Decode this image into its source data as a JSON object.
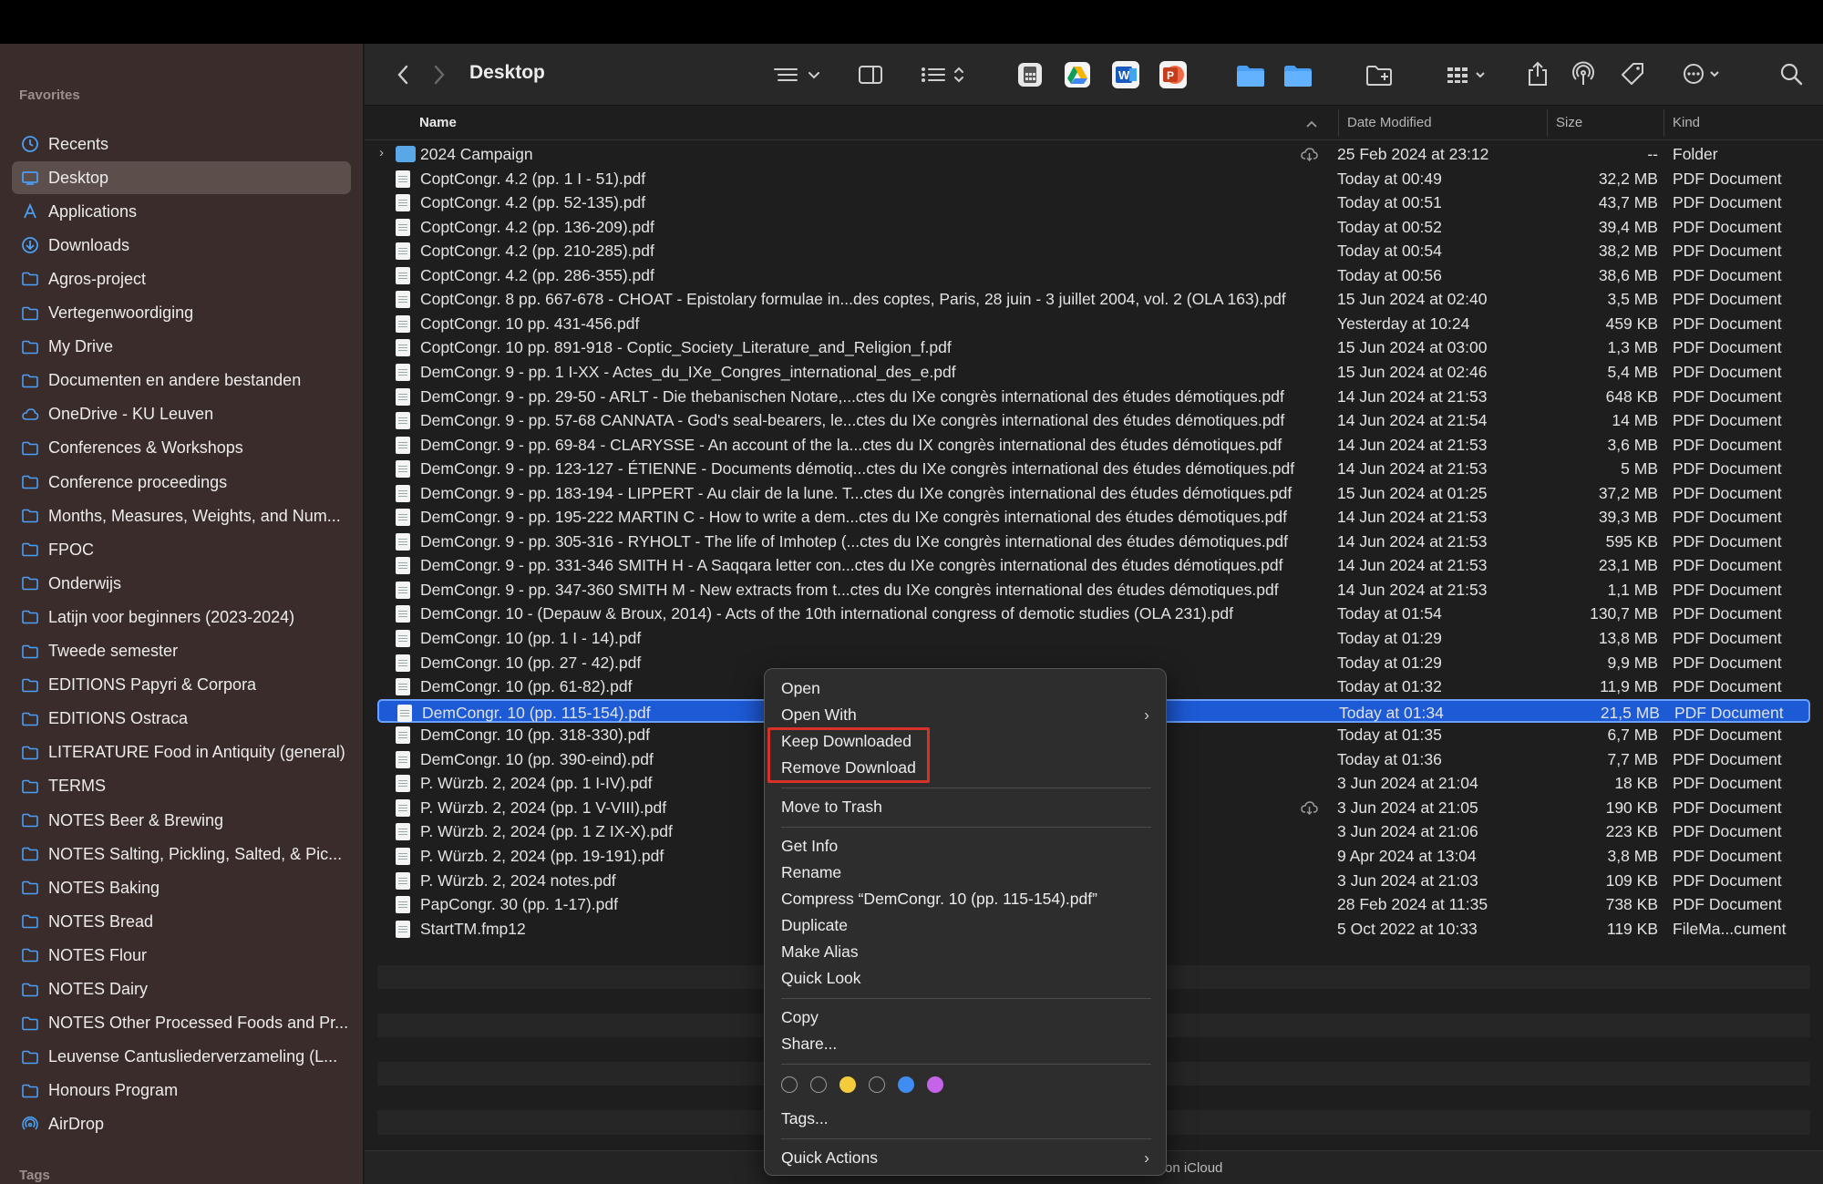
{
  "window": {
    "title": "Desktop",
    "status_text": "on iCloud"
  },
  "sidebar": {
    "favorites_label": "Favorites",
    "tags_label": "Tags",
    "items": [
      {
        "label": "Recents",
        "icon": "clock-icon"
      },
      {
        "label": "Desktop",
        "icon": "desktop-icon",
        "active": true
      },
      {
        "label": "Applications",
        "icon": "applications-icon"
      },
      {
        "label": "Downloads",
        "icon": "download-icon"
      },
      {
        "label": "Agros-project",
        "icon": "folder-icon"
      },
      {
        "label": "Vertegenwoordiging",
        "icon": "folder-icon"
      },
      {
        "label": "My Drive",
        "icon": "folder-icon"
      },
      {
        "label": "Documenten en andere bestanden",
        "icon": "folder-icon"
      },
      {
        "label": "OneDrive - KU Leuven",
        "icon": "cloud-icon"
      },
      {
        "label": "Conferences & Workshops",
        "icon": "folder-icon"
      },
      {
        "label": "Conference proceedings",
        "icon": "folder-icon"
      },
      {
        "label": "Months, Measures, Weights, and Num...",
        "icon": "folder-icon"
      },
      {
        "label": "FPOC",
        "icon": "folder-icon"
      },
      {
        "label": "Onderwijs",
        "icon": "folder-icon"
      },
      {
        "label": "Latijn voor beginners (2023-2024)",
        "icon": "folder-icon"
      },
      {
        "label": "Tweede semester",
        "icon": "folder-icon"
      },
      {
        "label": "EDITIONS Papyri & Corpora",
        "icon": "folder-icon"
      },
      {
        "label": "EDITIONS Ostraca",
        "icon": "folder-icon"
      },
      {
        "label": "LITERATURE Food in Antiquity (general)",
        "icon": "folder-icon"
      },
      {
        "label": "TERMS",
        "icon": "folder-icon"
      },
      {
        "label": "NOTES Beer & Brewing",
        "icon": "folder-icon"
      },
      {
        "label": "NOTES Salting, Pickling, Salted, & Pic...",
        "icon": "folder-icon"
      },
      {
        "label": "NOTES Baking",
        "icon": "folder-icon"
      },
      {
        "label": "NOTES Bread",
        "icon": "folder-icon"
      },
      {
        "label": "NOTES Flour",
        "icon": "folder-icon"
      },
      {
        "label": "NOTES Dairy",
        "icon": "folder-icon"
      },
      {
        "label": "NOTES Other Processed Foods and Pr...",
        "icon": "folder-icon"
      },
      {
        "label": "Leuvense Cantusliederverzameling (L...",
        "icon": "folder-icon"
      },
      {
        "label": "Honours Program",
        "icon": "folder-icon"
      },
      {
        "label": "AirDrop",
        "icon": "airdrop-icon"
      }
    ]
  },
  "columns": {
    "name": "Name",
    "date": "Date Modified",
    "size": "Size",
    "kind": "Kind"
  },
  "files": [
    {
      "name": "2024 Campaign",
      "date": "25 Feb 2024 at 23:12",
      "size": "--",
      "kind": "Folder",
      "folder": true,
      "cloud": true
    },
    {
      "name": "CoptCongr. 4.2 (pp. 1 I - 51).pdf",
      "date": "Today at 00:49",
      "size": "32,2 MB",
      "kind": "PDF Document"
    },
    {
      "name": "CoptCongr. 4.2 (pp. 52-135).pdf",
      "date": "Today at 00:51",
      "size": "43,7 MB",
      "kind": "PDF Document"
    },
    {
      "name": "CoptCongr. 4.2 (pp. 136-209).pdf",
      "date": "Today at 00:52",
      "size": "39,4 MB",
      "kind": "PDF Document"
    },
    {
      "name": "CoptCongr. 4.2 (pp. 210-285).pdf",
      "date": "Today at 00:54",
      "size": "38,2 MB",
      "kind": "PDF Document"
    },
    {
      "name": "CoptCongr. 4.2 (pp. 286-355).pdf",
      "date": "Today at 00:56",
      "size": "38,6 MB",
      "kind": "PDF Document"
    },
    {
      "name": "CoptCongr. 8 pp. 667-678 - CHOAT - Epistolary formulae in...des coptes, Paris, 28 juin - 3 juillet 2004, vol. 2 (OLA 163).pdf",
      "date": "15 Jun 2024 at 02:40",
      "size": "3,5 MB",
      "kind": "PDF Document"
    },
    {
      "name": "CoptCongr. 10 pp. 431-456.pdf",
      "date": "Yesterday at 10:24",
      "size": "459 KB",
      "kind": "PDF Document"
    },
    {
      "name": "CoptCongr. 10 pp. 891-918 - Coptic_Society_Literature_and_Religion_f.pdf",
      "date": "15 Jun 2024 at 03:00",
      "size": "1,3 MB",
      "kind": "PDF Document"
    },
    {
      "name": "DemCongr. 9 - pp. 1 I-XX - Actes_du_IXe_Congres_international_des_e.pdf",
      "date": "15 Jun 2024 at 02:46",
      "size": "5,4 MB",
      "kind": "PDF Document"
    },
    {
      "name": "DemCongr. 9 - pp. 29-50 - ARLT - Die thebanischen Notare,...ctes du IXe congrès international des études démotiques.pdf",
      "date": "14 Jun 2024 at 21:53",
      "size": "648 KB",
      "kind": "PDF Document"
    },
    {
      "name": "DemCongr. 9 - pp. 57-68 CANNATA - God's seal-bearers, le...ctes du IXe congrès international des études démotiques.pdf",
      "date": "14 Jun 2024 at 21:54",
      "size": "14 MB",
      "kind": "PDF Document"
    },
    {
      "name": "DemCongr. 9 - pp. 69-84 - CLARYSSE - An account of the la...ctes du IX congrès international des études démotiques.pdf",
      "date": "14 Jun 2024 at 21:53",
      "size": "3,6 MB",
      "kind": "PDF Document"
    },
    {
      "name": "DemCongr. 9 - pp. 123-127 - ÉTIENNE - Documents démotiq...ctes du IXe congrès international des études démotiques.pdf",
      "date": "14 Jun 2024 at 21:53",
      "size": "5 MB",
      "kind": "PDF Document"
    },
    {
      "name": "DemCongr. 9 - pp. 183-194 - LIPPERT - Au clair de la lune. T...ctes du IXe congrès international des études démotiques.pdf",
      "date": "15 Jun 2024 at 01:25",
      "size": "37,2 MB",
      "kind": "PDF Document"
    },
    {
      "name": "DemCongr. 9 - pp. 195-222 MARTIN C - How to write a dem...ctes du IXe congrès international des études démotiques.pdf",
      "date": "14 Jun 2024 at 21:53",
      "size": "39,3 MB",
      "kind": "PDF Document"
    },
    {
      "name": "DemCongr. 9 - pp. 305-316 - RYHOLT - The life of Imhotep (...ctes du IXe congrès international des études démotiques.pdf",
      "date": "14 Jun 2024 at 21:53",
      "size": "595 KB",
      "kind": "PDF Document"
    },
    {
      "name": "DemCongr. 9 - pp. 331-346 SMITH H - A Saqqara letter con...ctes du IXe congrès international des études démotiques.pdf",
      "date": "14 Jun 2024 at 21:53",
      "size": "23,1 MB",
      "kind": "PDF Document"
    },
    {
      "name": "DemCongr. 9 - pp. 347-360 SMITH M - New extracts from t...ctes du IXe congrès international des études démotiques.pdf",
      "date": "14 Jun 2024 at 21:53",
      "size": "1,1 MB",
      "kind": "PDF Document"
    },
    {
      "name": "DemCongr. 10 - (Depauw & Broux, 2014) - Acts of the 10th international congress of demotic studies (OLA 231).pdf",
      "date": "Today at 01:54",
      "size": "130,7 MB",
      "kind": "PDF Document"
    },
    {
      "name": "DemCongr. 10 (pp. 1 I - 14).pdf",
      "date": "Today at 01:29",
      "size": "13,8 MB",
      "kind": "PDF Document"
    },
    {
      "name": "DemCongr. 10 (pp. 27 - 42).pdf",
      "date": "Today at 01:29",
      "size": "9,9 MB",
      "kind": "PDF Document"
    },
    {
      "name": "DemCongr. 10 (pp. 61-82).pdf",
      "date": "Today at 01:32",
      "size": "11,9 MB",
      "kind": "PDF Document"
    },
    {
      "name": "DemCongr. 10 (pp. 115-154).pdf",
      "date": "Today at 01:34",
      "size": "21,5 MB",
      "kind": "PDF Document",
      "selected": true
    },
    {
      "name": "DemCongr. 10 (pp. 318-330).pdf",
      "date": "Today at 01:35",
      "size": "6,7 MB",
      "kind": "PDF Document"
    },
    {
      "name": "DemCongr. 10 (pp. 390-eind).pdf",
      "date": "Today at 01:36",
      "size": "7,7 MB",
      "kind": "PDF Document"
    },
    {
      "name": "P. Würzb. 2, 2024 (pp. 1 I-IV).pdf",
      "date": "3 Jun 2024 at 21:04",
      "size": "18 KB",
      "kind": "PDF Document"
    },
    {
      "name": "P. Würzb. 2, 2024 (pp. 1 V-VIII).pdf",
      "date": "3 Jun 2024 at 21:05",
      "size": "190 KB",
      "kind": "PDF Document",
      "cloud": true
    },
    {
      "name": "P. Würzb. 2, 2024 (pp. 1 Z IX-X).pdf",
      "date": "3 Jun 2024 at 21:06",
      "size": "223 KB",
      "kind": "PDF Document"
    },
    {
      "name": "P. Würzb. 2, 2024 (pp. 19-191).pdf",
      "date": "9 Apr 2024 at 13:04",
      "size": "3,8 MB",
      "kind": "PDF Document"
    },
    {
      "name": "P. Würzb. 2, 2024 notes.pdf",
      "date": "3 Jun 2024 at 21:03",
      "size": "109 KB",
      "kind": "PDF Document"
    },
    {
      "name": "PapCongr. 30 (pp. 1-17).pdf",
      "date": "28 Feb 2024 at 11:35",
      "size": "738 KB",
      "kind": "PDF Document"
    },
    {
      "name": "StartTM.fmp12",
      "date": "5 Oct 2022 at 10:33",
      "size": "119 KB",
      "kind": "FileMa...cument"
    }
  ],
  "context_menu": {
    "open": "Open",
    "open_with": "Open With",
    "keep_downloaded": "Keep Downloaded",
    "remove_download": "Remove Download",
    "move_to_trash": "Move to Trash",
    "get_info": "Get Info",
    "rename": "Rename",
    "compress": "Compress “DemCongr. 10 (pp. 115-154).pdf”",
    "duplicate": "Duplicate",
    "make_alias": "Make Alias",
    "quick_look": "Quick Look",
    "copy": "Copy",
    "share": "Share...",
    "tags": "Tags...",
    "quick_actions": "Quick Actions",
    "tag_colors": [
      "none",
      "none",
      "#f4cc3b",
      "none",
      "#3f8cf3",
      "#c564e8"
    ],
    "highlight_color": "#d8312a"
  },
  "colors": {
    "selection": "#1d5ad6",
    "sidebar_bg": "#3a2c2a",
    "accent_icon": "#4a9ff5"
  }
}
